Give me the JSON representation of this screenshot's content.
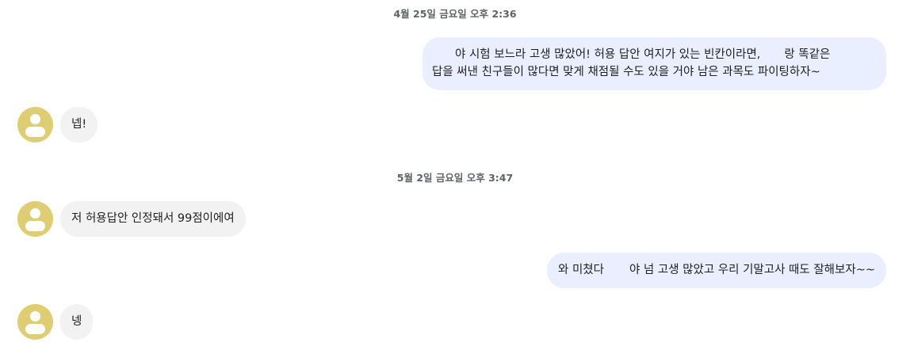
{
  "chat": {
    "date_1": "4월 25일 금요일 오후 2:36",
    "date_2": "5월 2일 금요일 오후 3:47",
    "msg_1_line1_a": "야 시험 보느라 고생 많았어! 허용 답안 여지가 있는 빈칸이라면,",
    "msg_1_line1_b": "랑 똑같은",
    "msg_1_line2": "답을 써낸 친구들이 많다면 맞게 채점될 수도 있을 거야 남은 과목도 파이팅하자~",
    "msg_2": "넵!",
    "msg_3": "저 허용답안 인정돼서 99점이에여",
    "msg_4_a": "와 미쳤다",
    "msg_4_b": "야 넘 고생 많았고 우리 기말고사 때도 잘해보자~~",
    "msg_5": "넹"
  },
  "colors": {
    "outgoing_bubble": "#e9efff",
    "incoming_bubble": "#f2f2f2",
    "avatar": "#dfcd73"
  },
  "icons": {
    "avatar": "person-avatar-icon"
  }
}
